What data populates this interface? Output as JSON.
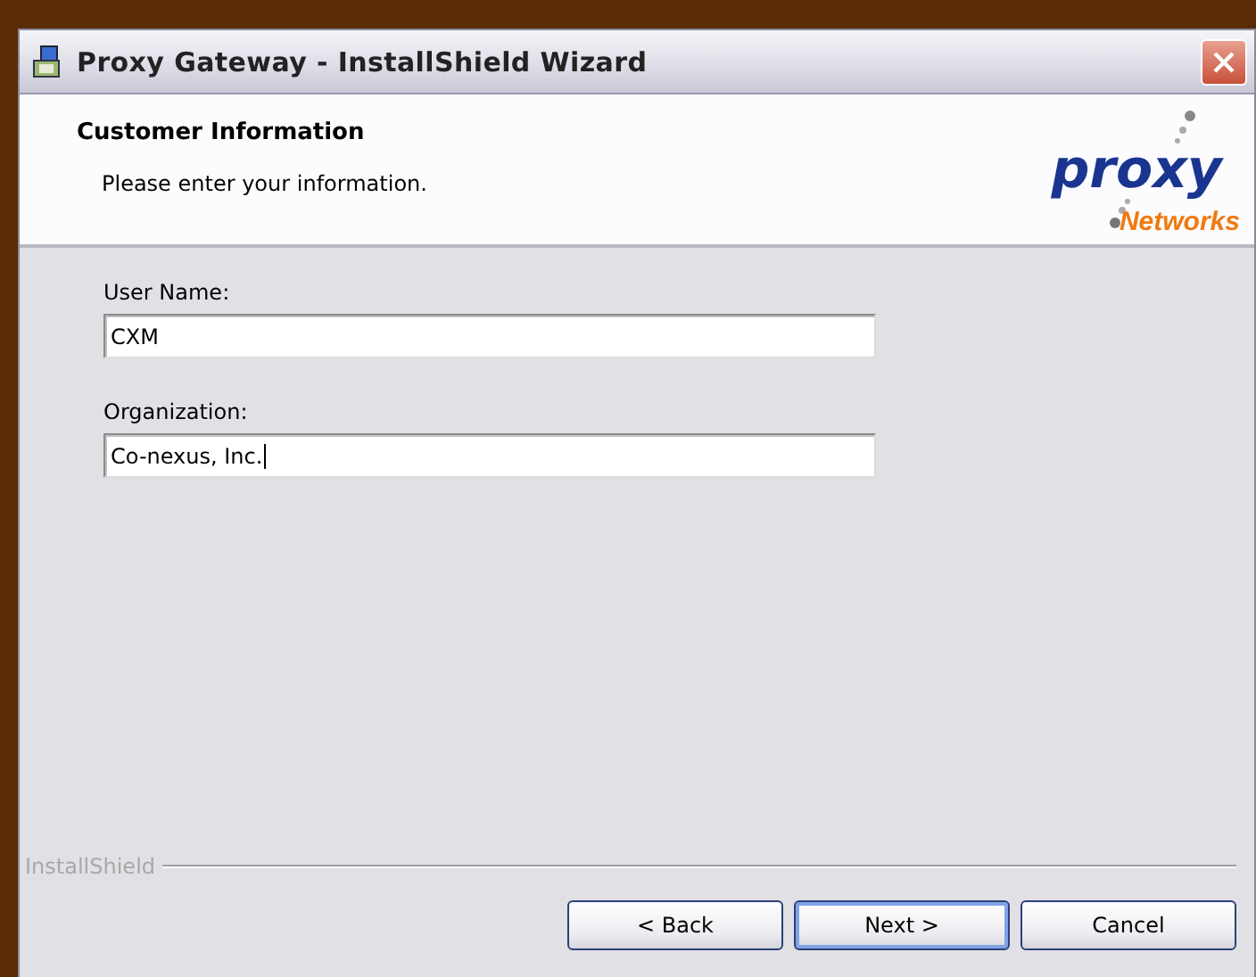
{
  "window": {
    "title": "Proxy Gateway - InstallShield Wizard"
  },
  "header": {
    "title": "Customer Information",
    "subtitle": "Please enter your information.",
    "logo": {
      "word": "proxy",
      "sub": "Networks"
    }
  },
  "fields": [
    {
      "label": "User Name:",
      "value": "CXM",
      "focused": false
    },
    {
      "label": "Organization:",
      "value": "Co-nexus, Inc.",
      "focused": true
    }
  ],
  "footer": {
    "brand": "InstallShield"
  },
  "buttons": [
    {
      "label": "< Back",
      "default": false
    },
    {
      "label": "Next >",
      "default": true
    },
    {
      "label": "Cancel",
      "default": false
    }
  ]
}
